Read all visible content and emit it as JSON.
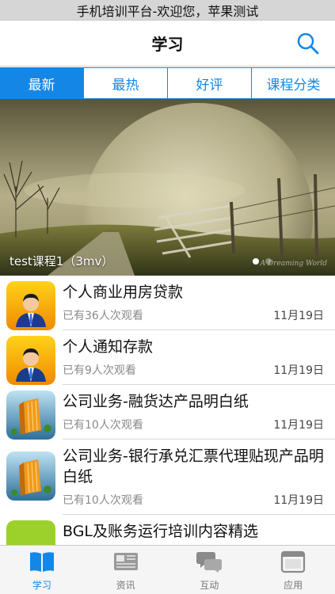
{
  "status_bar": {
    "text": "手机培训平台-欢迎您，苹果测试"
  },
  "nav": {
    "title": "学习",
    "search_icon": "search-icon"
  },
  "tabs": [
    {
      "label": "最新",
      "active": true
    },
    {
      "label": "最热",
      "active": false
    },
    {
      "label": "好评",
      "active": false
    },
    {
      "label": "课程分类",
      "active": false
    }
  ],
  "banner": {
    "caption": "test课程1（3mv）",
    "page_count": 2,
    "current_page": 1,
    "signature": "A Dreaming World"
  },
  "courses": [
    {
      "title": "个人商业用房贷款",
      "views": "已有36人次观看",
      "date": "11月19日",
      "icon": "person-icon"
    },
    {
      "title": "个人通知存款",
      "views": "已有9人次观看",
      "date": "11月19日",
      "icon": "person-icon"
    },
    {
      "title": "公司业务-融货达产品明白纸",
      "views": "已有10人次观看",
      "date": "11月19日",
      "icon": "building-icon"
    },
    {
      "title": "公司业务-银行承兑汇票代理贴现产品明白纸",
      "views": "已有10人次观看",
      "date": "11月19日",
      "icon": "building-icon"
    },
    {
      "title": "BGL及账务运行培训内容精选",
      "views": "",
      "date": "",
      "icon": "green-icon"
    }
  ],
  "tabbar": [
    {
      "label": "学习",
      "icon": "book-icon",
      "active": true
    },
    {
      "label": "资讯",
      "icon": "news-icon",
      "active": false
    },
    {
      "label": "互动",
      "icon": "chat-icon",
      "active": false
    },
    {
      "label": "应用",
      "icon": "app-window-icon",
      "active": false
    }
  ],
  "colors": {
    "accent": "#1487e6",
    "status_bar": "#d6d6d6",
    "tabbar": "#f5f5f5"
  }
}
